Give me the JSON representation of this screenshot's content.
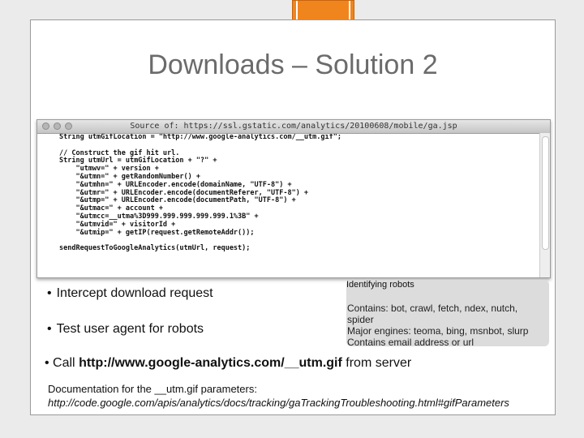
{
  "slide": {
    "title": "Downloads – Solution 2"
  },
  "browser_window": {
    "title": "Source of: https://ssl.gstatic.com/analytics/20100608/mobile/ga.jsp",
    "code_lines": [
      "String utmGifLocation = \"http://www.google-analytics.com/__utm.gif\";",
      "",
      "// Construct the gif hit url.",
      "String utmUrl = utmGifLocation + \"?\" +",
      "    \"utmwv=\" + version +",
      "    \"&utmn=\" + getRandomNumber() +",
      "    \"&utmhn=\" + URLEncoder.encode(domainName, \"UTF-8\") +",
      "    \"&utmr=\" + URLEncoder.encode(documentReferer, \"UTF-8\") +",
      "    \"&utmp=\" + URLEncoder.encode(documentPath, \"UTF-8\") +",
      "    \"&utmac=\" + account +",
      "    \"&utmcc=__utma%3D999.999.999.999.999.1%3B\" +",
      "    \"&utmvid=\" + visitorId +",
      "    \"&utmip=\" + getIP(request.getRemoteAddr());",
      "",
      "sendRequestToGoogleAnalytics(utmUrl, request);"
    ]
  },
  "bullets": {
    "intercept": "Intercept download request",
    "test_agent": "Test user agent for robots",
    "call_prefix": "Call ",
    "call_url": "http://www.google-analytics.com/__utm.gif",
    "call_suffix": " from server"
  },
  "callout": {
    "title": "Identifying robots",
    "lines": [
      "Contains: bot, crawl, fetch, ndex, nutch,",
      "spider",
      "Major engines: teoma, bing, msnbot, slurp",
      "Contains email address or url"
    ]
  },
  "documentation": {
    "label": "Documentation for the __utm.gif parameters:",
    "url": "http://code.google.com/apis/analytics/docs/tracking/gaTrackingTroubleshooting.html#gifParameters"
  },
  "colors": {
    "accent": "#f0851e",
    "title_gray": "#6b6b6b",
    "callout_bg": "#dcdcdc"
  }
}
